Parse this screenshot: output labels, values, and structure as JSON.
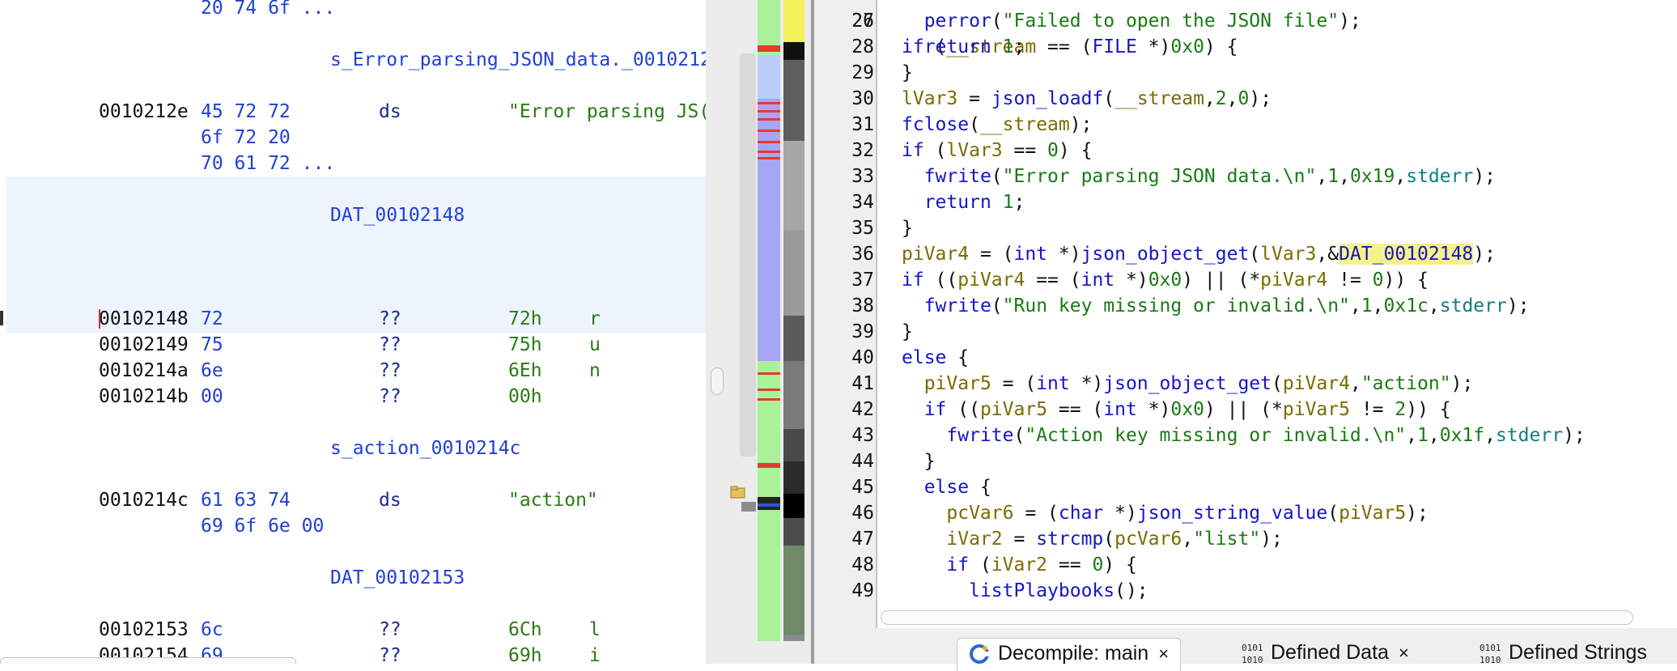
{
  "listing": {
    "lines": [
      {
        "bytes": "20 74 6f ..."
      },
      {
        "label": "s_Error_parsing_JSON_data._0010212"
      },
      {
        "addr": "0010212e",
        "bytes": "45 72 72",
        "mnem": "ds",
        "operand": "\"Error parsing JS("
      },
      {
        "bytes": "6f 72 20"
      },
      {
        "bytes": "70 61 72 ..."
      },
      {
        "label": "DAT_00102148"
      },
      {
        "addr": "00102148",
        "bytes": "72",
        "mnem": "??",
        "operand": "72h",
        "char": "r"
      },
      {
        "addr": "00102149",
        "bytes": "75",
        "mnem": "??",
        "operand": "75h",
        "char": "u"
      },
      {
        "addr": "0010214a",
        "bytes": "6e",
        "mnem": "??",
        "operand": "6Eh",
        "char": "n"
      },
      {
        "addr": "0010214b",
        "bytes": "00",
        "mnem": "??",
        "operand": "00h",
        "char": ""
      },
      {
        "label": "s_action_0010214c"
      },
      {
        "addr": "0010214c",
        "bytes": "61 63 74",
        "mnem": "ds",
        "operand": "\"action\""
      },
      {
        "bytes": "69 6f 6e 00"
      },
      {
        "label": "DAT_00102153"
      },
      {
        "addr": "00102153",
        "bytes": "6c",
        "mnem": "??",
        "operand": "6Ch",
        "char": "l"
      },
      {
        "addr": "00102154",
        "bytes": "69",
        "mnem": "??",
        "operand": "69h",
        "char": "i"
      }
    ]
  },
  "decompiler": {
    "lines": [
      {
        "n": "27",
        "toks": [
          [
            "p",
            "  "
          ],
          [
            "f",
            "perror"
          ],
          [
            "p",
            "("
          ],
          [
            "s",
            "\"Failed to open the JSON file\""
          ],
          [
            "p",
            ");"
          ]
        ]
      },
      {
        "n": "28",
        "toks": [
          [
            "p",
            "  "
          ],
          [
            "k",
            "return"
          ],
          [
            "p",
            " "
          ],
          [
            "n",
            "1"
          ],
          [
            "p",
            ";"
          ]
        ]
      },
      {
        "n": "29",
        "toks": [
          [
            "p",
            "}"
          ]
        ]
      },
      {
        "n": "30",
        "toks": [
          [
            "v",
            "lVar3"
          ],
          [
            "p",
            " = "
          ],
          [
            "f",
            "json_loadf"
          ],
          [
            "p",
            "("
          ],
          [
            "v",
            "__stream"
          ],
          [
            "p",
            ","
          ],
          [
            "n",
            "2"
          ],
          [
            "p",
            ","
          ],
          [
            "n",
            "0"
          ],
          [
            "p",
            ");"
          ]
        ]
      },
      {
        "n": "31",
        "toks": [
          [
            "f",
            "fclose"
          ],
          [
            "p",
            "("
          ],
          [
            "v",
            "__stream"
          ],
          [
            "p",
            ");"
          ]
        ]
      },
      {
        "n": "32",
        "toks": [
          [
            "k",
            "if"
          ],
          [
            "p",
            " ("
          ],
          [
            "v",
            "lVar3"
          ],
          [
            "p",
            " == "
          ],
          [
            "n",
            "0"
          ],
          [
            "p",
            ") {"
          ]
        ]
      },
      {
        "n": "33",
        "toks": [
          [
            "p",
            "  "
          ],
          [
            "f",
            "fwrite"
          ],
          [
            "p",
            "("
          ],
          [
            "s",
            "\"Error parsing JSON data.\\n\""
          ],
          [
            "p",
            ","
          ],
          [
            "n",
            "1"
          ],
          [
            "p",
            ","
          ],
          [
            "n",
            "0x19"
          ],
          [
            "p",
            ","
          ],
          [
            "g",
            "stderr"
          ],
          [
            "p",
            ");"
          ]
        ]
      },
      {
        "n": "34",
        "toks": [
          [
            "p",
            "  "
          ],
          [
            "k",
            "return"
          ],
          [
            "p",
            " "
          ],
          [
            "n",
            "1"
          ],
          [
            "p",
            ";"
          ]
        ]
      },
      {
        "n": "35",
        "toks": [
          [
            "p",
            "}"
          ]
        ]
      },
      {
        "n": "36",
        "toks": [
          [
            "v",
            "piVar4"
          ],
          [
            "p",
            " = ("
          ],
          [
            "t",
            "int"
          ],
          [
            "p",
            " *)"
          ],
          [
            "f",
            "json_object_get"
          ],
          [
            "p",
            "("
          ],
          [
            "v",
            "lVar3"
          ],
          [
            "p",
            ",&"
          ],
          [
            "h",
            "DAT_00102148"
          ],
          [
            "p",
            ");"
          ]
        ]
      },
      {
        "n": "37",
        "toks": [
          [
            "k",
            "if"
          ],
          [
            "p",
            " (("
          ],
          [
            "v",
            "piVar4"
          ],
          [
            "p",
            " == ("
          ],
          [
            "t",
            "int"
          ],
          [
            "p",
            " *)"
          ],
          [
            "n",
            "0x0"
          ],
          [
            "p",
            ") || (*"
          ],
          [
            "v",
            "piVar4"
          ],
          [
            "p",
            " != "
          ],
          [
            "n",
            "0"
          ],
          [
            "p",
            ")) {"
          ]
        ]
      },
      {
        "n": "38",
        "toks": [
          [
            "p",
            "  "
          ],
          [
            "f",
            "fwrite"
          ],
          [
            "p",
            "("
          ],
          [
            "s",
            "\"Run key missing or invalid.\\n\""
          ],
          [
            "p",
            ","
          ],
          [
            "n",
            "1"
          ],
          [
            "p",
            ","
          ],
          [
            "n",
            "0x1c"
          ],
          [
            "p",
            ","
          ],
          [
            "g",
            "stderr"
          ],
          [
            "p",
            ");"
          ]
        ]
      },
      {
        "n": "39",
        "toks": [
          [
            "p",
            "}"
          ]
        ]
      },
      {
        "n": "40",
        "toks": [
          [
            "k",
            "else"
          ],
          [
            "p",
            " {"
          ]
        ]
      },
      {
        "n": "41",
        "toks": [
          [
            "p",
            "  "
          ],
          [
            "v",
            "piVar5"
          ],
          [
            "p",
            " = ("
          ],
          [
            "t",
            "int"
          ],
          [
            "p",
            " *)"
          ],
          [
            "f",
            "json_object_get"
          ],
          [
            "p",
            "("
          ],
          [
            "v",
            "piVar4"
          ],
          [
            "p",
            ","
          ],
          [
            "s",
            "\"action\""
          ],
          [
            "p",
            ");"
          ]
        ]
      },
      {
        "n": "42",
        "toks": [
          [
            "p",
            "  "
          ],
          [
            "k",
            "if"
          ],
          [
            "p",
            " (("
          ],
          [
            "v",
            "piVar5"
          ],
          [
            "p",
            " == ("
          ],
          [
            "t",
            "int"
          ],
          [
            "p",
            " *)"
          ],
          [
            "n",
            "0x0"
          ],
          [
            "p",
            ") || (*"
          ],
          [
            "v",
            "piVar5"
          ],
          [
            "p",
            " != "
          ],
          [
            "n",
            "2"
          ],
          [
            "p",
            ")) {"
          ]
        ]
      },
      {
        "n": "43",
        "toks": [
          [
            "p",
            "    "
          ],
          [
            "f",
            "fwrite"
          ],
          [
            "p",
            "("
          ],
          [
            "s",
            "\"Action key missing or invalid.\\n\""
          ],
          [
            "p",
            ","
          ],
          [
            "n",
            "1"
          ],
          [
            "p",
            ","
          ],
          [
            "n",
            "0x1f"
          ],
          [
            "p",
            ","
          ],
          [
            "g",
            "stderr"
          ],
          [
            "p",
            ");"
          ]
        ]
      },
      {
        "n": "44",
        "toks": [
          [
            "p",
            "  }"
          ]
        ]
      },
      {
        "n": "45",
        "toks": [
          [
            "p",
            "  "
          ],
          [
            "k",
            "else"
          ],
          [
            "p",
            " {"
          ]
        ]
      },
      {
        "n": "46",
        "toks": [
          [
            "p",
            "    "
          ],
          [
            "v",
            "pcVar6"
          ],
          [
            "p",
            " = ("
          ],
          [
            "t",
            "char"
          ],
          [
            "p",
            " *)"
          ],
          [
            "f",
            "json_string_value"
          ],
          [
            "p",
            "("
          ],
          [
            "v",
            "piVar5"
          ],
          [
            "p",
            ");"
          ]
        ]
      },
      {
        "n": "47",
        "toks": [
          [
            "p",
            "    "
          ],
          [
            "v",
            "iVar2"
          ],
          [
            "p",
            " = "
          ],
          [
            "f",
            "strcmp"
          ],
          [
            "p",
            "("
          ],
          [
            "v",
            "pcVar6"
          ],
          [
            "p",
            ","
          ],
          [
            "s",
            "\"list\""
          ],
          [
            "p",
            ");"
          ]
        ]
      },
      {
        "n": "48",
        "toks": [
          [
            "p",
            "    "
          ],
          [
            "k",
            "if"
          ],
          [
            "p",
            " ("
          ],
          [
            "v",
            "iVar2"
          ],
          [
            "p",
            " == "
          ],
          [
            "n",
            "0"
          ],
          [
            "p",
            ") {"
          ]
        ]
      },
      {
        "n": "49",
        "toks": [
          [
            "p",
            "      "
          ],
          [
            "f",
            "listPlaybooks"
          ],
          [
            "p",
            "();"
          ]
        ]
      }
    ]
  },
  "tabs": [
    {
      "label": "Decompile: main",
      "icon": "decompiler-icon",
      "close": "×"
    },
    {
      "label": "Defined Data",
      "icon": "binary-data-icon",
      "close": "×"
    },
    {
      "label": "Defined Strings",
      "icon": "binary-data-icon",
      "close": ""
    }
  ],
  "colors": {
    "listing_highlight": "#eef4fd",
    "overview_green": "#a9f29b",
    "overview_gray": "#8a8a8a",
    "symbol_highlight": "#f6f28a",
    "bookmark_red": "#e33c2a"
  }
}
